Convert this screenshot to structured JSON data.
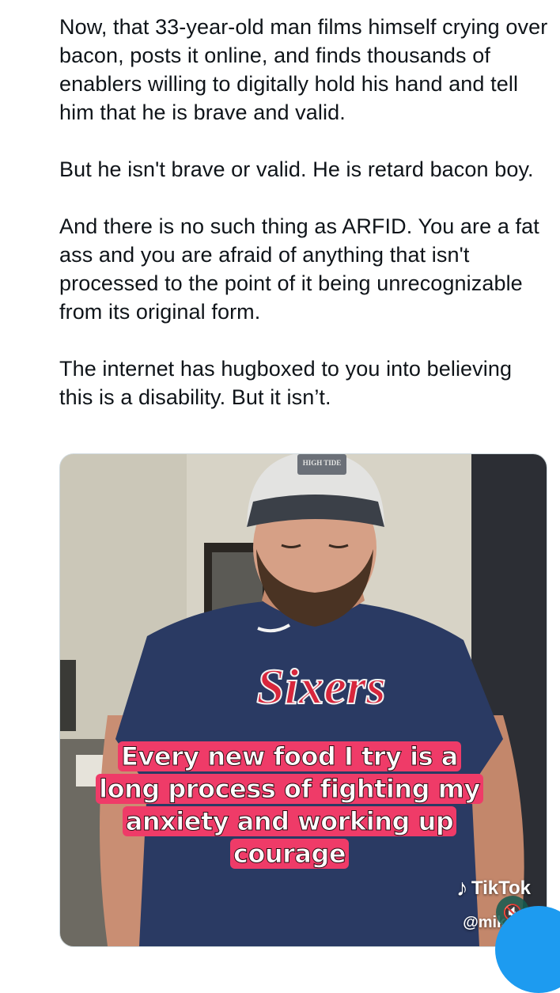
{
  "tweet": {
    "paragraphs": [
      "Now, that 33-year-old man films himself crying over bacon, posts it online, and finds thousands of enablers willing to digitally hold his hand and tell him that he is brave and valid.",
      "But he isn't brave or valid. He is retard bacon boy.",
      "And there is no such thing as ARFID. You are a fat ass and you are afraid of anything that isn't processed to the point of it being unrecognizable from its original form.",
      "The internet has hugboxed to you into believing this is a disability. But it isn’t."
    ]
  },
  "media": {
    "caption": "Every new food I try is a long process of fighting my anxiety and working up courage",
    "shirt_text": "Sixers",
    "hat_text": "HIGH TIDE",
    "watermark_brand": "TikTok",
    "watermark_handle": "@mikeyw",
    "mute_icon": "speaker-muted-icon"
  },
  "colors": {
    "caption_bg": "#ef3b68",
    "shirt": "#2a3a63",
    "fab": "#1d9bf0"
  }
}
